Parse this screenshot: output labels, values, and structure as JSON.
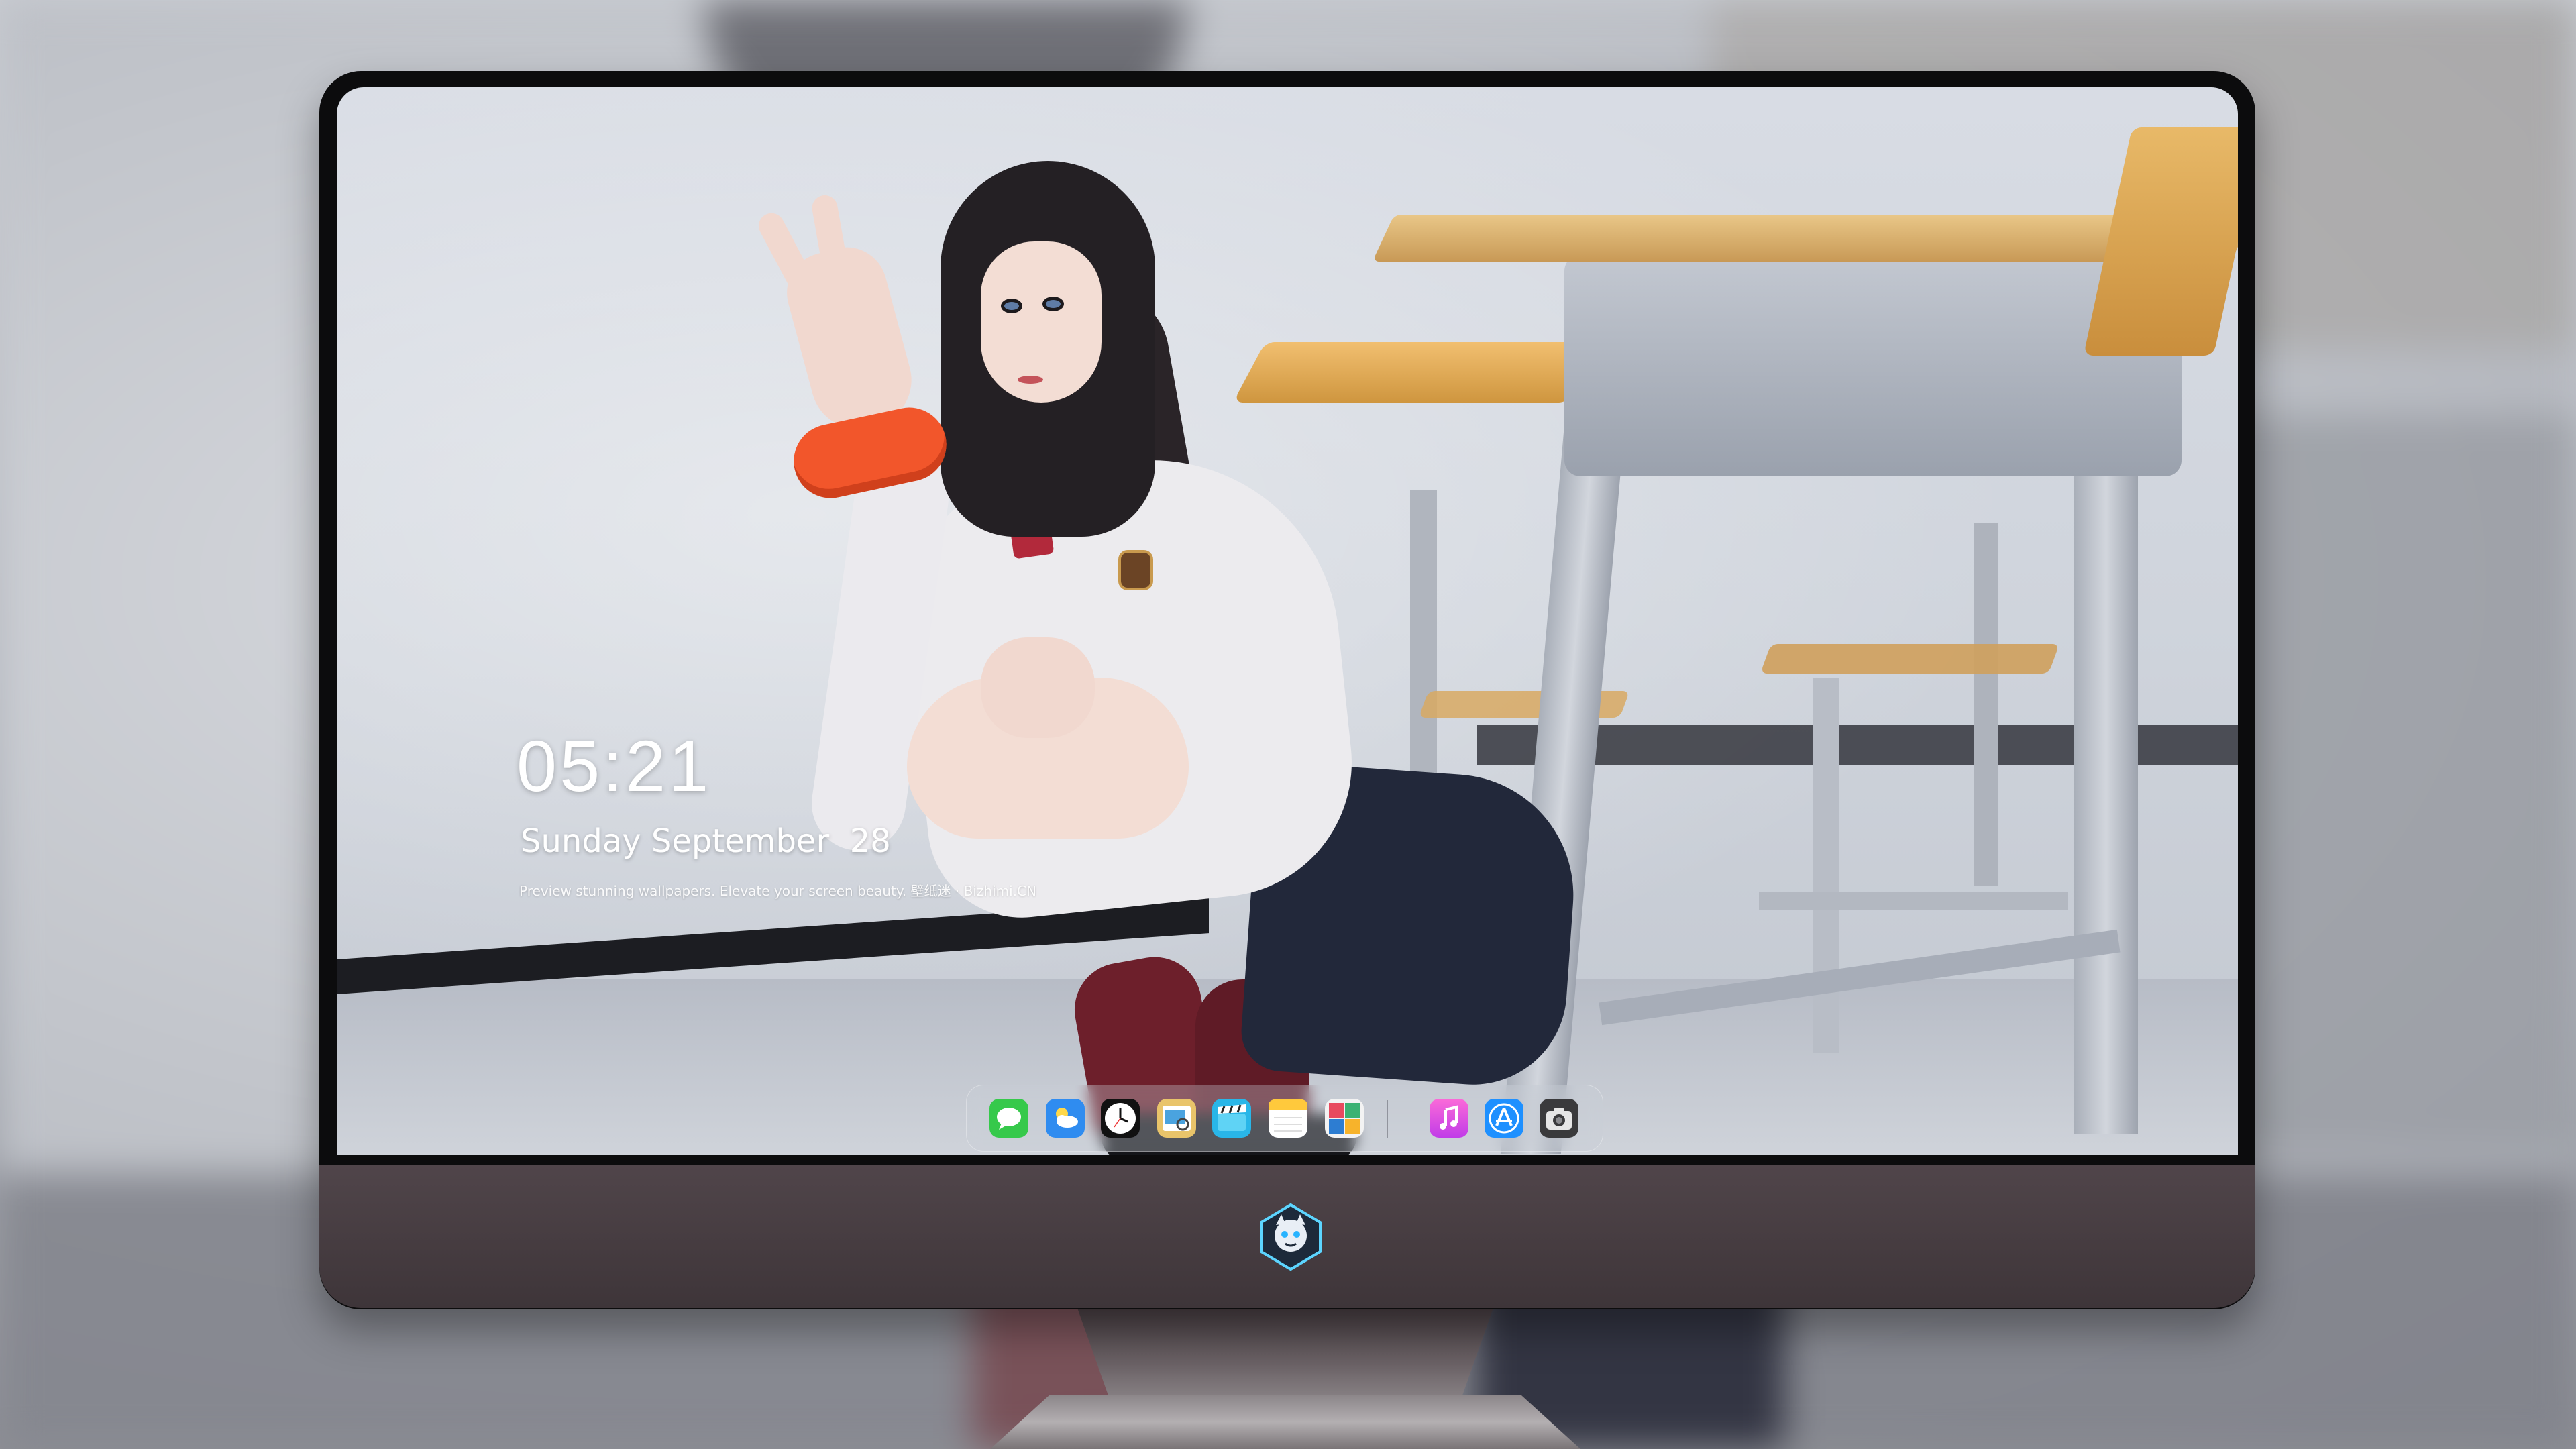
{
  "lock_screen": {
    "time": "05:21",
    "date": "Sunday September  28",
    "tagline": "Preview stunning wallpapers. Elevate your screen beauty. 壁纸迷 · Bizhimi.CN"
  },
  "dock": {
    "apps": [
      {
        "name": "Messages",
        "icon": "messages-icon"
      },
      {
        "name": "Weather",
        "icon": "weather-icon"
      },
      {
        "name": "Clock",
        "icon": "clock-icon"
      },
      {
        "name": "Preview",
        "icon": "preview-icon"
      },
      {
        "name": "Clips",
        "icon": "clips-icon"
      },
      {
        "name": "Notes",
        "icon": "notes-icon"
      },
      {
        "name": "Photo Booth",
        "icon": "photo-booth-icon"
      },
      {
        "name": "iTunes",
        "icon": "itunes-icon"
      },
      {
        "name": "App Store",
        "icon": "app-store-icon"
      },
      {
        "name": "Camera",
        "icon": "camera-icon"
      }
    ]
  },
  "colors": {
    "bezel": "#0c0c0d",
    "chin": "#463d41",
    "messages": "#36c94b",
    "weather": "#2f8cf0",
    "itunes": "#f05fd5",
    "app_store": "#1e90ff"
  }
}
